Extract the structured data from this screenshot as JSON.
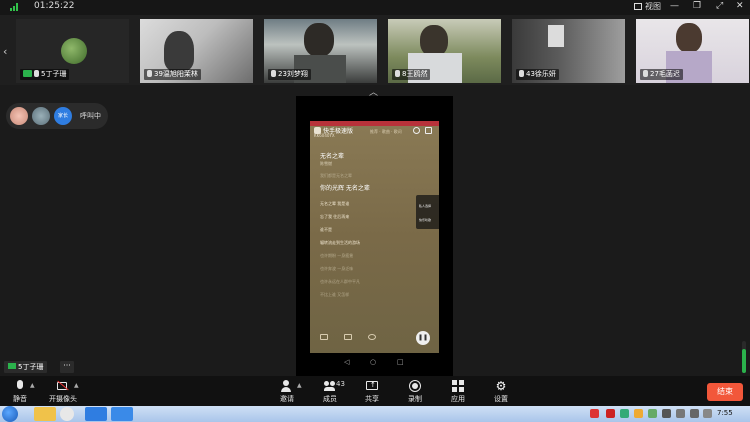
{
  "window": {
    "timer": "01:25:22",
    "view_label": "视图"
  },
  "participants": [
    {
      "name": "5丁子珊",
      "camera": "off"
    },
    {
      "name": "39温旭阳茉林",
      "camera": "on"
    },
    {
      "name": "23刘梦翔",
      "camera": "on"
    },
    {
      "name": "8王鸥然",
      "camera": "on"
    },
    {
      "name": "43徐乐妍",
      "camera": "on"
    },
    {
      "name": "27毛菡迟",
      "camera": "on"
    }
  ],
  "calling": {
    "avatar3_text": "家长",
    "label": "呼叫中"
  },
  "shared_screen": {
    "app_name": "快手极速版",
    "room_id": "KK6040YX",
    "tabs": "推荐 · 歌曲 · 歌词",
    "song_title": "无名之辈",
    "artist": "陈雪燃",
    "lyrics": [
      {
        "text": "我们都是无名之辈",
        "style": "dim"
      },
      {
        "text": "你的光辉 无名之辈",
        "style": "hl"
      },
      {
        "text": "无名之辈 我是谁",
        "style": "normal"
      },
      {
        "text": "忘了我 往后再来",
        "style": "normal"
      },
      {
        "text": "谁不是",
        "style": "normal"
      },
      {
        "text": "辗转流走到生活的游场",
        "style": "normal"
      },
      {
        "text": "也许期盼 一身疲惫",
        "style": "dim"
      },
      {
        "text": "也许奔波 一身乏味",
        "style": "dim"
      },
      {
        "text": "也许永远在人群中平凡",
        "style": "dim"
      },
      {
        "text": "不比上谁 又怎样",
        "style": "dim"
      }
    ],
    "sidebar_labels": [
      "私人选择",
      "快乐听歌"
    ]
  },
  "self_label": "5丁子珊",
  "toolbar": {
    "mute": "静音",
    "camera": "开摄像头",
    "invite": "邀请",
    "members": "成员",
    "member_count": "43",
    "share": "共享",
    "record": "录制",
    "apps": "应用",
    "settings": "设置",
    "end": "结束"
  },
  "taskbar": {
    "clock": "7:55"
  },
  "colors": {
    "accent_green": "#2bb24c",
    "end_button": "#f2573a",
    "phone_red": "#b8323a"
  }
}
